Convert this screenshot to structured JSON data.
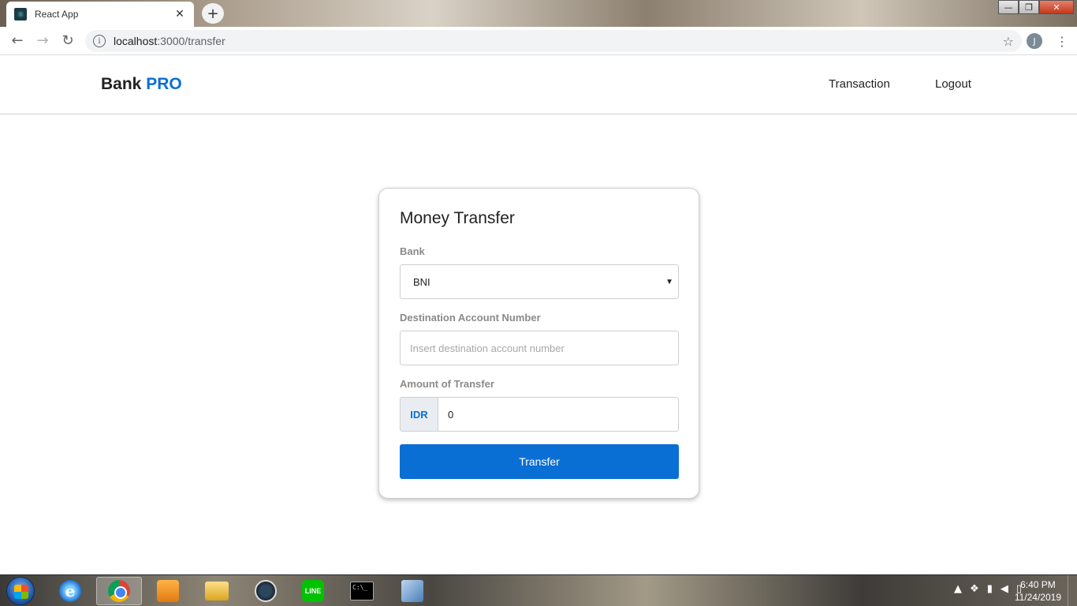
{
  "browser": {
    "tab_title": "React App",
    "tab_close": "✕",
    "new_tab": "+",
    "window_controls": {
      "minimize": "—",
      "maximize": "❐",
      "close": "✕"
    },
    "url_host": "localhost",
    "url_path": ":3000/transfer",
    "info": "i",
    "star": "☆",
    "avatar_initial": "J",
    "menu": "⋮",
    "back": "←",
    "forward": "→",
    "reload": "↻"
  },
  "navbar": {
    "brand_main": "Bank",
    "brand_accent": "PRO",
    "links": [
      "Transaction",
      "Logout"
    ]
  },
  "form": {
    "title": "Money Transfer",
    "bank_label": "Bank",
    "bank_value": "BNI",
    "dest_label": "Destination Account Number",
    "dest_placeholder": "Insert destination account number",
    "dest_value": "",
    "amount_label": "Amount of Transfer",
    "currency": "IDR",
    "amount_value": "0",
    "submit_label": "Transfer"
  },
  "taskbar": {
    "apps": [
      "windows-start",
      "internet-explorer",
      "chrome",
      "media-player",
      "file-explorer",
      "steam",
      "line",
      "command-prompt",
      "virtualbox"
    ],
    "active_app": "chrome",
    "line_text": "LINE",
    "cmd_text": "C:\\_",
    "ie_letter": "e",
    "time": "6:40 PM",
    "date": "11/24/2019"
  },
  "colors": {
    "accent": "#0a6fd4",
    "text": "#222222",
    "label": "#8a8a8a",
    "border": "#cfcfcf"
  }
}
